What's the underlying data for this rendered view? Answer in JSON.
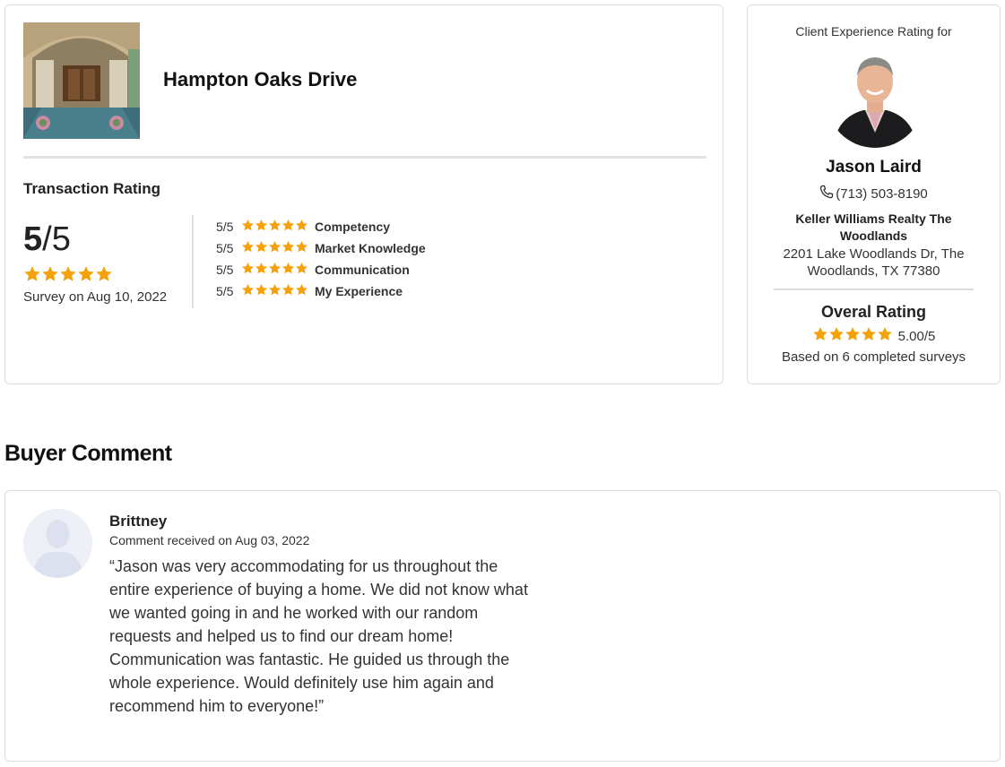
{
  "transaction": {
    "property_title": "Hampton Oaks Drive",
    "heading": "Transaction Rating",
    "score": "5",
    "score_max": "/5",
    "star_count": 5,
    "survey_date": "Survey on Aug 10, 2022",
    "criteria": [
      {
        "score": "5/5",
        "label": "Competency",
        "stars": 5
      },
      {
        "score": "5/5",
        "label": "Market Knowledge",
        "stars": 5
      },
      {
        "score": "5/5",
        "label": "Communication",
        "stars": 5
      },
      {
        "score": "5/5",
        "label": "My Experience",
        "stars": 5
      }
    ]
  },
  "agent": {
    "kicker": "Client Experience Rating for",
    "name": "Jason Laird",
    "phone": "(713) 503-8190",
    "company": "Keller Williams Realty The Woodlands",
    "address": "2201 Lake Woodlands Dr, The Woodlands, TX 77380",
    "overall_heading": "Overal Rating",
    "overall_score": "5.00/5",
    "overall_stars": 5,
    "basis": "Based on 6 completed surveys"
  },
  "comments": {
    "section_title": "Buyer Comment",
    "items": [
      {
        "author": "Brittney",
        "date": "Comment received on Aug 03, 2022",
        "text": "“Jason was very accommodating for us throughout the entire experience of buying a home. We did not know what we wanted going in and he worked with our random requests and helped us to find our dream home! Communication was fantastic. He guided us through the whole experience. Would definitely use him again and recommend him to everyone!”"
      }
    ]
  },
  "colors": {
    "star": "#f5a10a",
    "border": "#dcdcdc",
    "divider": "#e2e2e2"
  },
  "icons": {
    "phone": "phone-icon",
    "star": "star-icon",
    "avatar": "person-silhouette-icon"
  }
}
